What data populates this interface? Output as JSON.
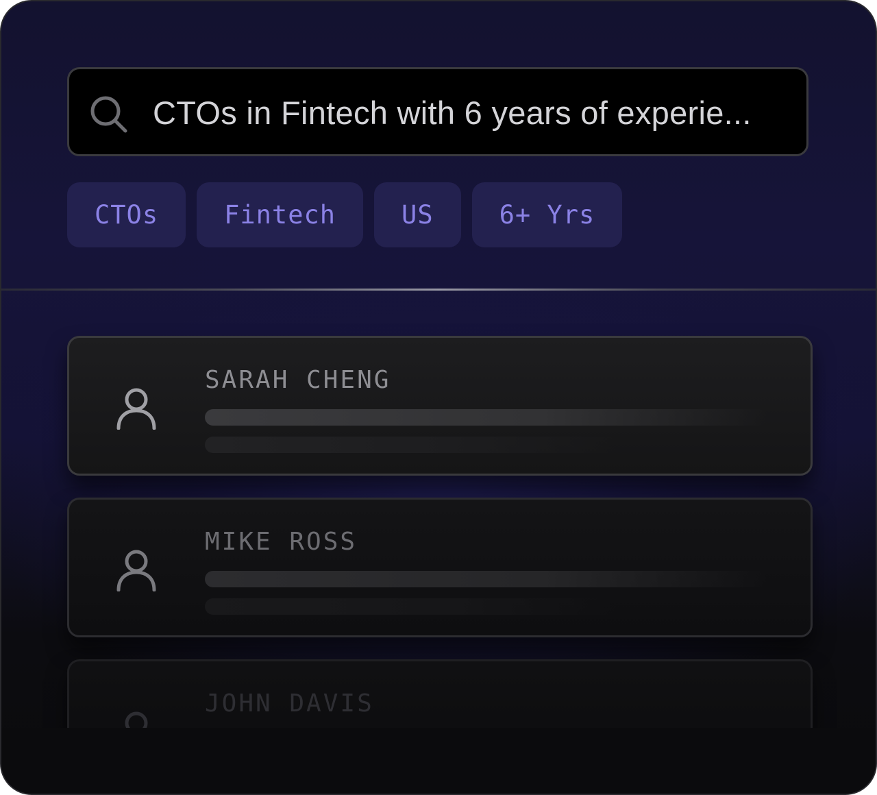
{
  "search": {
    "query": "CTOs in Fintech with 6 years of experie..."
  },
  "filters": [
    {
      "label": "CTOs"
    },
    {
      "label": "Fintech"
    },
    {
      "label": "US"
    },
    {
      "label": "6+ Yrs"
    }
  ],
  "results": [
    {
      "name": "SARAH CHENG",
      "icon": "user-icon"
    },
    {
      "name": "MIKE ROSS",
      "icon": "user-icon"
    },
    {
      "name": "JOHN DAVIS",
      "icon": "user-icon"
    }
  ],
  "colors": {
    "chip_background": "#23214f",
    "chip_text": "#8b82e6",
    "search_background": "#000000"
  }
}
